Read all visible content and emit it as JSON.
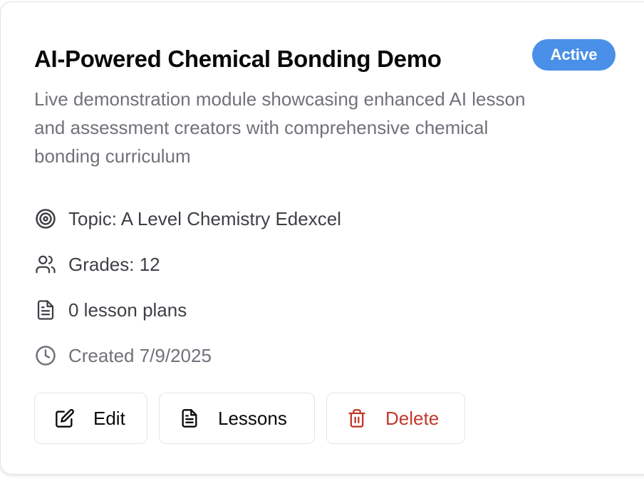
{
  "card": {
    "title": "AI-Powered Chemical Bonding Demo",
    "status_badge": "Active",
    "description": "Live demonstration module showcasing enhanced AI lesson and assessment creators with comprehensive chemical bonding curriculum",
    "meta": {
      "topic": "Topic: A Level Chemistry Edexcel",
      "grades": "Grades: 12",
      "lesson_plans": "0 lesson plans",
      "created": "Created 7/9/2025"
    },
    "actions": {
      "edit_label": "Edit",
      "lessons_label": "Lessons",
      "delete_label": "Delete"
    },
    "icons": {
      "topic": "target-icon",
      "grades": "users-icon",
      "lesson_plans": "file-text-icon",
      "created": "clock-icon",
      "edit": "edit-icon",
      "lessons": "file-text-icon",
      "delete": "trash-icon"
    },
    "colors": {
      "badge": "#4a90e8",
      "delete": "#c0392b",
      "text": "#09090b",
      "muted": "#71717a"
    }
  }
}
